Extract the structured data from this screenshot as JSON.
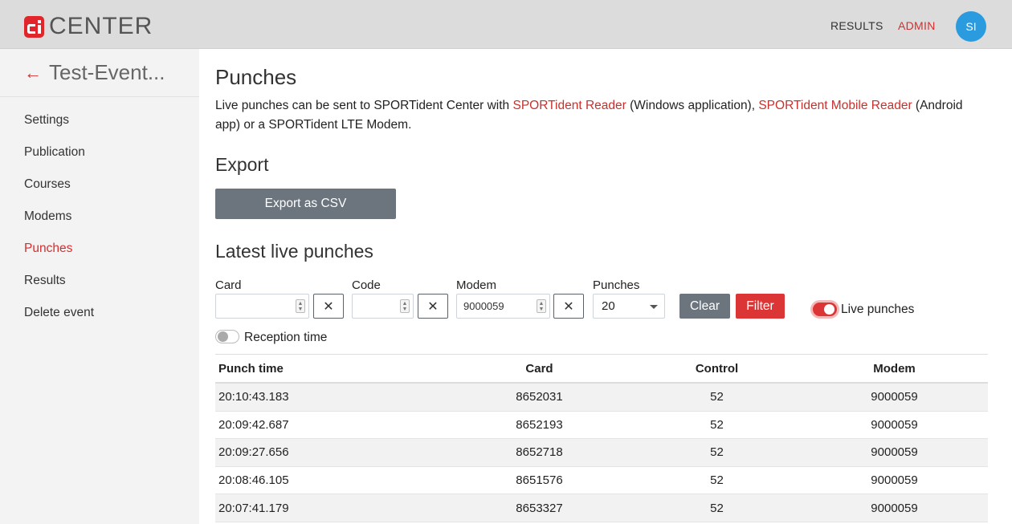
{
  "header": {
    "logo_text": "CENTER",
    "nav_results": "RESULTS",
    "nav_admin": "ADMIN",
    "avatar_initials": "SI"
  },
  "sidebar": {
    "event_name": "Test-Event...",
    "items": [
      {
        "label": "Settings"
      },
      {
        "label": "Publication"
      },
      {
        "label": "Courses"
      },
      {
        "label": "Modems"
      },
      {
        "label": "Punches"
      },
      {
        "label": "Results"
      },
      {
        "label": "Delete event"
      }
    ],
    "active_item": "Punches"
  },
  "main": {
    "title": "Punches",
    "intro": {
      "part1": "Live punches can be sent to SPORTident Center with ",
      "link1": "SPORTident Reader",
      "part2": " (Windows application), ",
      "link2": "SPORTident Mobile Reader",
      "part3": " (Android app) or a SPORTident LTE Modem."
    },
    "export_heading": "Export",
    "export_button": "Export as CSV",
    "latest_heading": "Latest live punches",
    "filters": {
      "card_label": "Card",
      "card_value": "",
      "code_label": "Code",
      "code_value": "",
      "modem_label": "Modem",
      "modem_value": "9000059",
      "punches_label": "Punches",
      "punches_value": "20",
      "clear_button": "Clear",
      "filter_button": "Filter",
      "live_punches_label": "Live punches",
      "live_punches_on": true,
      "reception_time_label": "Reception time",
      "reception_time_on": false
    },
    "table": {
      "columns": [
        "Punch time",
        "Card",
        "Control",
        "Modem"
      ],
      "rows": [
        [
          "20:10:43.183",
          "8652031",
          "52",
          "9000059"
        ],
        [
          "20:09:42.687",
          "8652193",
          "52",
          "9000059"
        ],
        [
          "20:09:27.656",
          "8652718",
          "52",
          "9000059"
        ],
        [
          "20:08:46.105",
          "8651576",
          "52",
          "9000059"
        ],
        [
          "20:07:41.179",
          "8653327",
          "52",
          "9000059"
        ]
      ]
    }
  },
  "colors": {
    "accent_red": "#d2302f",
    "topbar_bg": "#dcdcdc",
    "sidebar_bg": "#f3f3f3",
    "avatar_blue": "#2a9bdf",
    "secondary_button": "#6c757d"
  }
}
